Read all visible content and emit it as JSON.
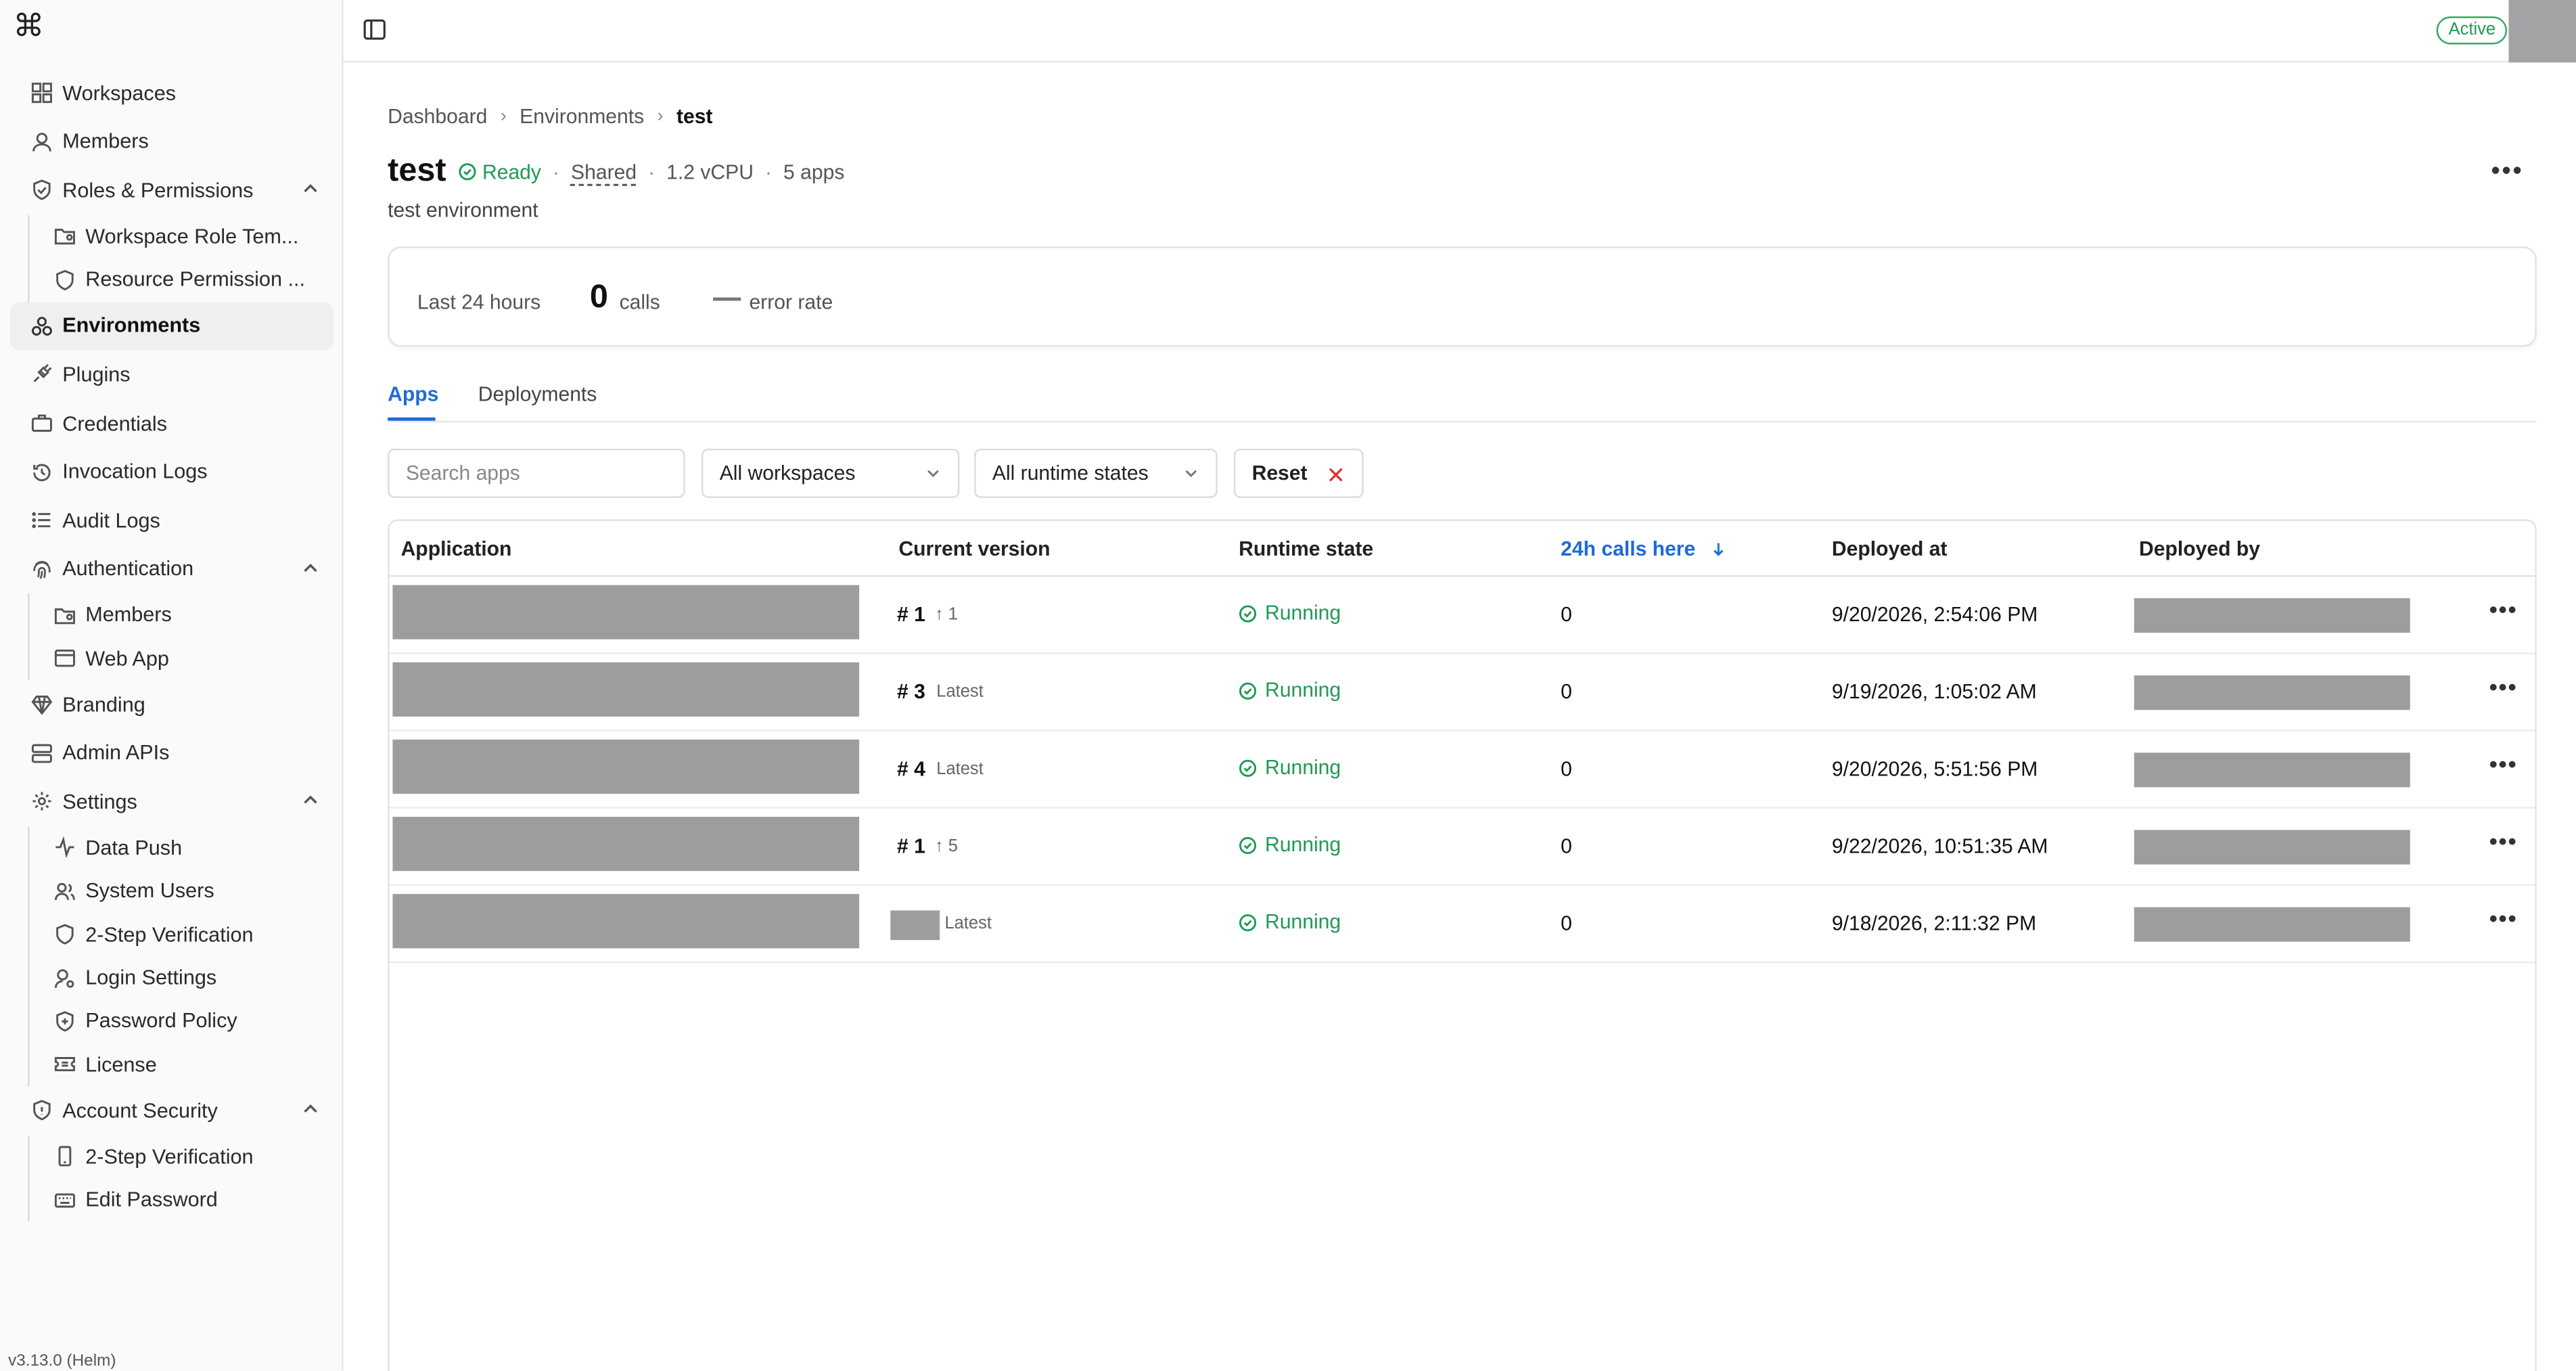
{
  "app": {
    "logo_glyph": "⌘",
    "version": "v3.13.0 (Helm)"
  },
  "sidebar": {
    "items": [
      {
        "label": "Workspaces",
        "icon": "grid-icon"
      },
      {
        "label": "Members",
        "icon": "user-icon"
      },
      {
        "label": "Roles & Permissions",
        "icon": "shield-check-icon",
        "expanded": true
      },
      {
        "label": "Environments",
        "icon": "boxes-icon",
        "active": true
      },
      {
        "label": "Plugins",
        "icon": "plug-icon"
      },
      {
        "label": "Credentials",
        "icon": "briefcase-icon"
      },
      {
        "label": "Invocation Logs",
        "icon": "history-icon"
      },
      {
        "label": "Audit Logs",
        "icon": "list-icon"
      },
      {
        "label": "Authentication",
        "icon": "fingerprint-icon",
        "expanded": true
      },
      {
        "label": "Branding",
        "icon": "gem-icon"
      },
      {
        "label": "Admin APIs",
        "icon": "server-icon"
      },
      {
        "label": "Settings",
        "icon": "gear-icon",
        "expanded": true
      },
      {
        "label": "Account Security",
        "icon": "shield-icon",
        "expanded": true
      }
    ],
    "roles_children": [
      {
        "label": "Workspace Role Tem...",
        "icon": "folder-user-icon"
      },
      {
        "label": "Resource Permission ...",
        "icon": "shield-icon"
      }
    ],
    "auth_children": [
      {
        "label": "Members",
        "icon": "folder-user-icon"
      },
      {
        "label": "Web App",
        "icon": "browser-icon"
      }
    ],
    "settings_children": [
      {
        "label": "Data Push",
        "icon": "activity-icon"
      },
      {
        "label": "System Users",
        "icon": "users-icon"
      },
      {
        "label": "2-Step Verification",
        "icon": "shield-icon"
      },
      {
        "label": "Login Settings",
        "icon": "user-cog-icon"
      },
      {
        "label": "Password Policy",
        "icon": "shield-plus-icon"
      },
      {
        "label": "License",
        "icon": "ticket-icon"
      }
    ],
    "account_children": [
      {
        "label": "2-Step Verification",
        "icon": "phone-icon"
      },
      {
        "label": "Edit Password",
        "icon": "keyboard-icon"
      }
    ]
  },
  "topbar": {
    "status_badge": "Active"
  },
  "breadcrumb": [
    "Dashboard",
    "Environments",
    "test"
  ],
  "environment": {
    "name": "test",
    "status": "Ready",
    "type": "Shared",
    "cpu": "1.2 vCPU",
    "apps_count": "5 apps",
    "description": "test environment"
  },
  "stats": {
    "period": "Last 24 hours",
    "calls": "0",
    "calls_label": "calls",
    "error_rate_label": "error rate"
  },
  "tabs": [
    "Apps",
    "Deployments"
  ],
  "filters": {
    "search_placeholder": "Search apps",
    "workspace": "All workspaces",
    "runtime": "All runtime states",
    "reset": "Reset"
  },
  "table": {
    "columns": [
      "Application",
      "Current version",
      "Runtime state",
      "24h calls here",
      "Deployed at",
      "Deployed by"
    ],
    "rows": [
      {
        "version": "# 1",
        "version_note": "↑ 1",
        "state": "Running",
        "calls": "0",
        "deployed_at": "9/20/2026, 2:54:06 PM"
      },
      {
        "version": "# 3",
        "version_note": "Latest",
        "state": "Running",
        "calls": "0",
        "deployed_at": "9/19/2026, 1:05:02 AM"
      },
      {
        "version": "# 4",
        "version_note": "Latest",
        "state": "Running",
        "calls": "0",
        "deployed_at": "9/20/2026, 5:51:56 PM"
      },
      {
        "version": "# 1",
        "version_note": "↑ 5",
        "state": "Running",
        "calls": "0",
        "deployed_at": "9/22/2026, 10:51:35 AM"
      },
      {
        "version": "",
        "version_note": "Latest",
        "state": "Running",
        "calls": "0",
        "deployed_at": "9/18/2026, 2:11:32 PM"
      }
    ]
  },
  "colors": {
    "accent": "#1e6bd6",
    "success": "#1f9a55",
    "redacted": "#9d9da0"
  }
}
